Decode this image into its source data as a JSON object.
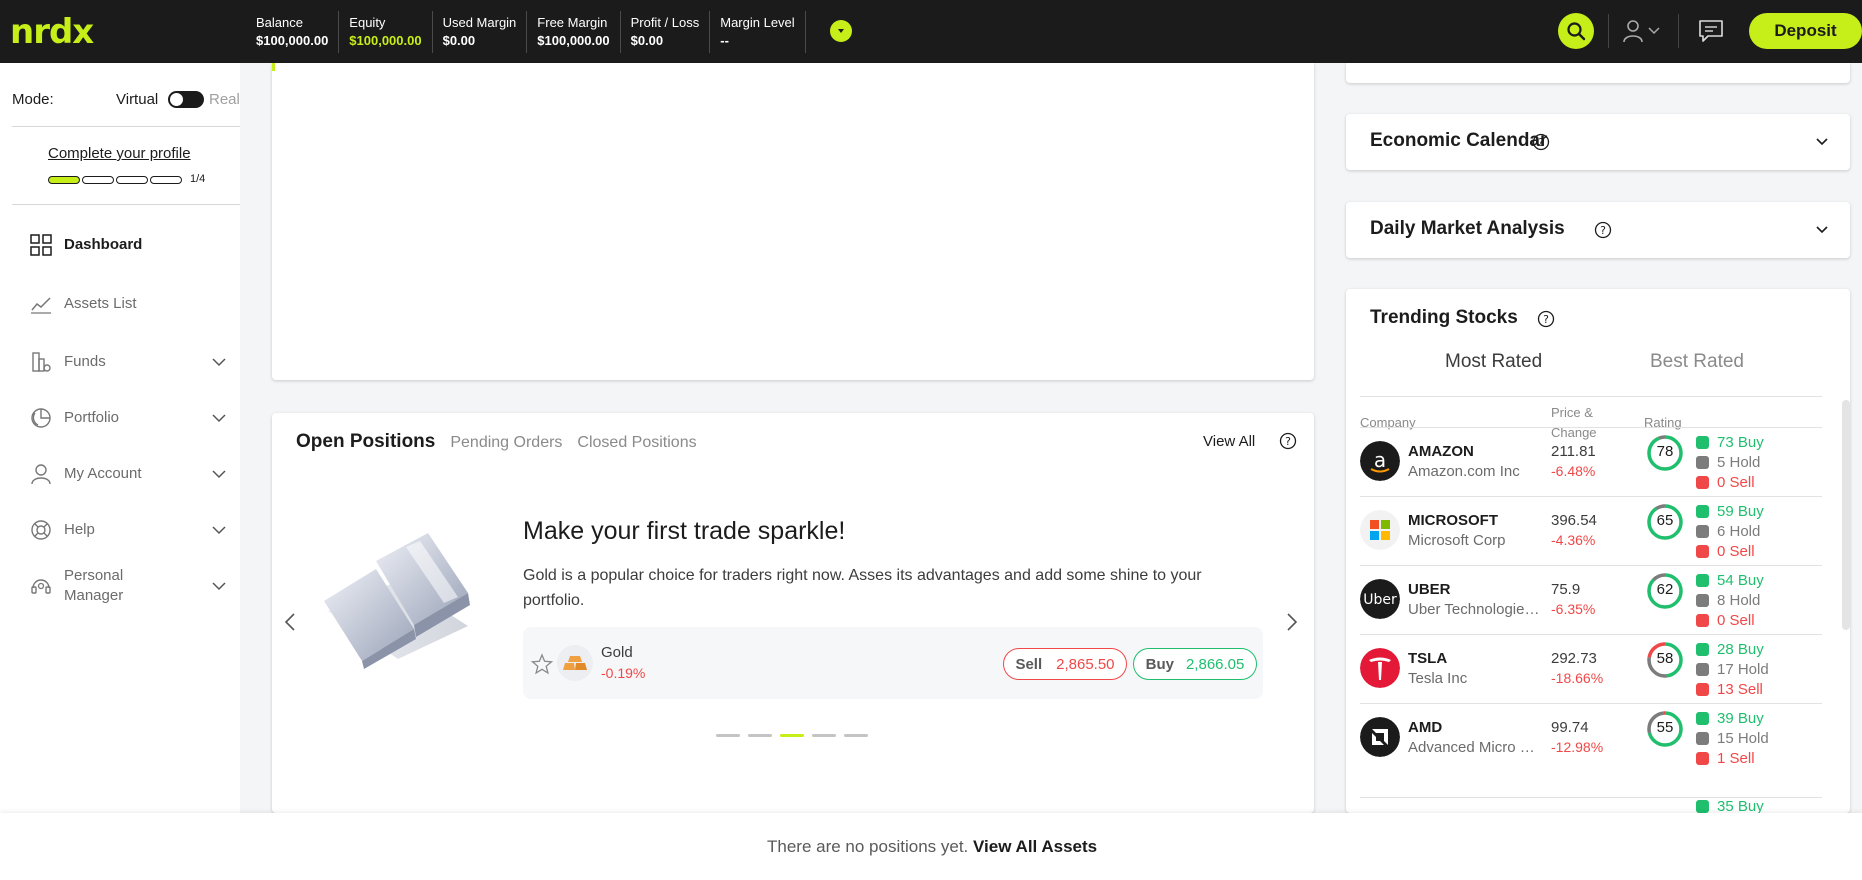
{
  "brand": {
    "logo_text": "nrdx",
    "accent": "#c6ee18",
    "dark": "#1b1b1b"
  },
  "header": {
    "stats": [
      {
        "label": "Balance",
        "value": "$100,000.00",
        "accent": false
      },
      {
        "label": "Equity",
        "value": "$100,000.00",
        "accent": true
      },
      {
        "label": "Used Margin",
        "value": "$0.00",
        "accent": false
      },
      {
        "label": "Free Margin",
        "value": "$100,000.00",
        "accent": false
      },
      {
        "label": "Profit / Loss",
        "value": "$0.00",
        "accent": false
      },
      {
        "label": "Margin Level",
        "value": "--",
        "accent": false
      }
    ],
    "deposit_label": "Deposit"
  },
  "sidebar": {
    "mode_label": "Mode:",
    "mode_virtual": "Virtual",
    "mode_real": "Real",
    "profile_link": "Complete your profile",
    "profile_progress": "1/4",
    "profile_steps_done": 1,
    "profile_steps_total": 4,
    "items": [
      {
        "label": "Dashboard",
        "icon": "grid-icon",
        "active": true,
        "expandable": false
      },
      {
        "label": "Assets List",
        "icon": "chart-line-icon",
        "active": false,
        "expandable": false
      },
      {
        "label": "Funds",
        "icon": "funds-icon",
        "active": false,
        "expandable": true
      },
      {
        "label": "Portfolio",
        "icon": "pie-chart-icon",
        "active": false,
        "expandable": true
      },
      {
        "label": "My Account",
        "icon": "user-icon",
        "active": false,
        "expandable": true
      },
      {
        "label": "Help",
        "icon": "lifebuoy-icon",
        "active": false,
        "expandable": true
      },
      {
        "label": "Personal Manager",
        "label_line1": "Personal",
        "label_line2": "Manager",
        "icon": "headset-icon",
        "active": false,
        "expandable": true
      }
    ]
  },
  "positions": {
    "tabs": [
      "Open Positions",
      "Pending Orders",
      "Closed Positions"
    ],
    "active_tab": "Open Positions",
    "view_all": "View All",
    "promo": {
      "title": "Make your first trade sparkle!",
      "text": "Gold is a popular choice for traders right now. Asses its advantages and add some shine to your portfolio.",
      "asset_name": "Gold",
      "asset_change": "-0.19%",
      "sell_label": "Sell",
      "sell_price": "2,865.50",
      "buy_label": "Buy",
      "buy_price": "2,866.05"
    },
    "carousel_slides": 5,
    "carousel_active": 3
  },
  "right_panel": {
    "economic_calendar": "Economic Calendar",
    "daily_analysis": "Daily Market Analysis",
    "trending": {
      "title": "Trending Stocks",
      "tabs": [
        "Most Rated",
        "Best Rated"
      ],
      "active_tab": "Most Rated",
      "headers": {
        "company": "Company",
        "price_line1": "Price &",
        "price_line2": "Change",
        "rating": "Rating"
      },
      "rows": [
        {
          "ticker": "AMAZON",
          "name": "Amazon.com Inc",
          "price": "211.81",
          "change": "-6.48%",
          "rating": "78",
          "buy": "73 Buy",
          "hold": "5 Hold",
          "sell": "0 Sell",
          "buy_n": 73,
          "hold_n": 5,
          "sell_n": 0,
          "logo": "amazon-logo"
        },
        {
          "ticker": "MICROSOFT",
          "name": "Microsoft Corp",
          "price": "396.54",
          "change": "-4.36%",
          "rating": "65",
          "buy": "59 Buy",
          "hold": "6 Hold",
          "sell": "0 Sell",
          "buy_n": 59,
          "hold_n": 6,
          "sell_n": 0,
          "logo": "microsoft-logo"
        },
        {
          "ticker": "UBER",
          "name": "Uber Technologies Inc",
          "price": "75.9",
          "change": "-6.35%",
          "rating": "62",
          "buy": "54 Buy",
          "hold": "8 Hold",
          "sell": "0 Sell",
          "buy_n": 54,
          "hold_n": 8,
          "sell_n": 0,
          "logo": "uber-logo"
        },
        {
          "ticker": "TSLA",
          "name": "Tesla Inc",
          "price": "292.73",
          "change": "-18.66%",
          "rating": "58",
          "buy": "28 Buy",
          "hold": "17 Hold",
          "sell": "13 Sell",
          "buy_n": 28,
          "hold_n": 17,
          "sell_n": 13,
          "logo": "tesla-logo"
        },
        {
          "ticker": "AMD",
          "name": "Advanced Micro Devices Inc",
          "price": "99.74",
          "change": "-12.98%",
          "rating": "55",
          "buy": "39 Buy",
          "hold": "15 Hold",
          "sell": "1 Sell",
          "buy_n": 39,
          "hold_n": 15,
          "sell_n": 1,
          "logo": "amd-logo"
        }
      ],
      "partial_next": "35 Buy"
    }
  },
  "bottom": {
    "text": "There are no positions yet.",
    "link": "View All Assets"
  },
  "colors": {
    "green": "#1fbf6e",
    "red": "#f04848",
    "grey": "#7c7c7c"
  }
}
